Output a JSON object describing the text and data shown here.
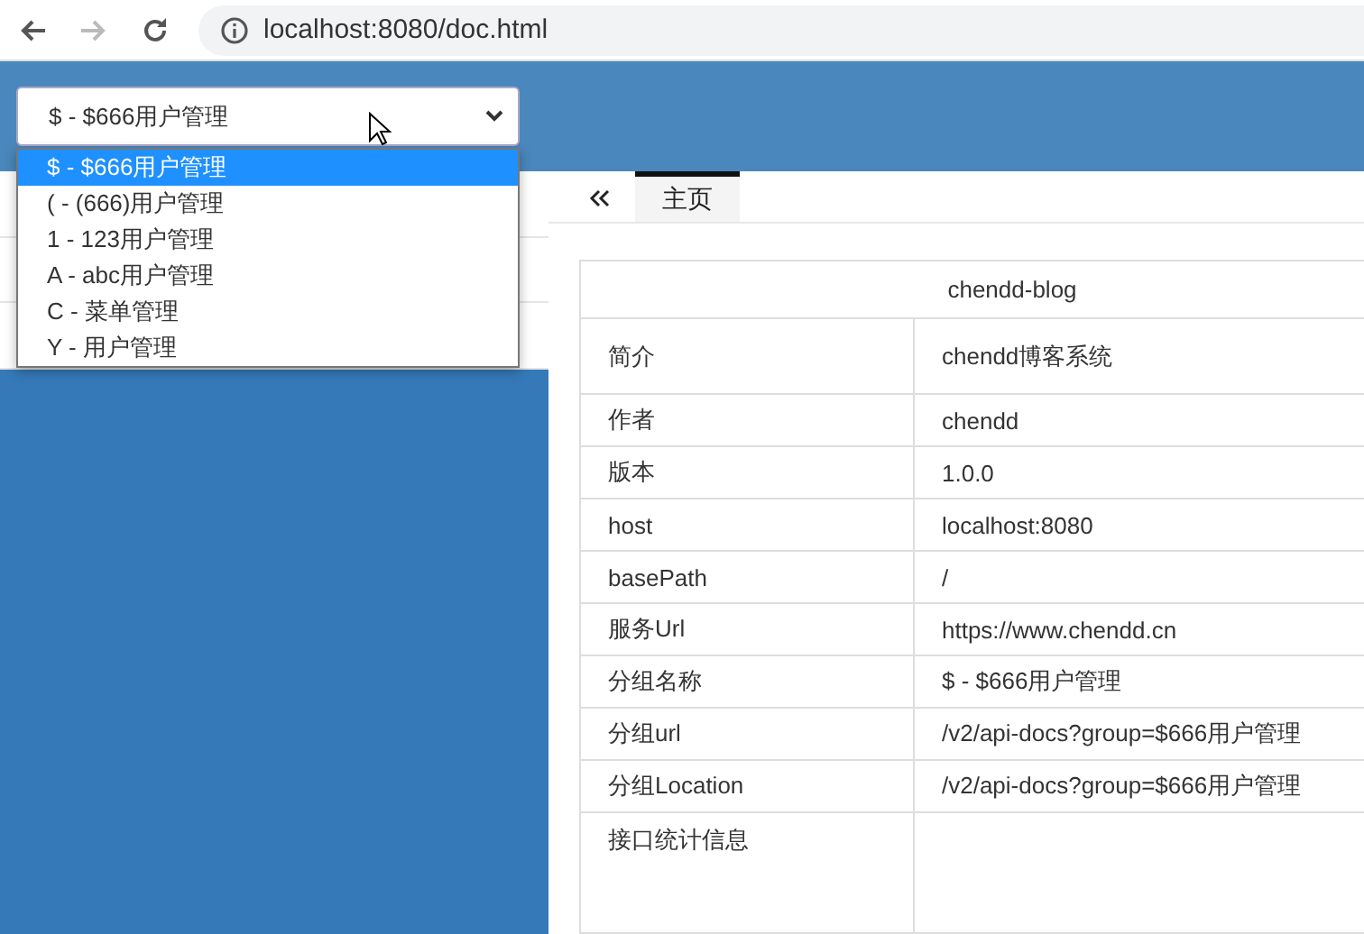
{
  "browser": {
    "nav": [
      {
        "kind": "back",
        "disabled": false
      },
      {
        "kind": "forward",
        "disabled": true
      },
      {
        "kind": "reload",
        "disabled": false
      }
    ],
    "url": "localhost:8080/doc.html"
  },
  "group_select": {
    "value": "$ - $666用户管理",
    "expanded": true,
    "options": [
      {
        "label": "$ - $666用户管理",
        "selected": true
      },
      {
        "label": "( - (666)用户管理",
        "selected": false
      },
      {
        "label": "1 - 123用户管理",
        "selected": false
      },
      {
        "label": "A - abc用户管理",
        "selected": false
      },
      {
        "label": "C - 菜单管理",
        "selected": false
      },
      {
        "label": "Y - 用户管理",
        "selected": false
      }
    ]
  },
  "tabs": [
    {
      "label": "主页",
      "selected": true
    }
  ],
  "info_table": {
    "title": "chendd-blog",
    "rows": [
      {
        "label": "简介",
        "value": "chendd博客系统"
      },
      {
        "label": "作者",
        "value": "chendd"
      },
      {
        "label": "版本",
        "value": "1.0.0"
      },
      {
        "label": "host",
        "value": "localhost:8080"
      },
      {
        "label": "basePath",
        "value": "/"
      },
      {
        "label": "服务Url",
        "value": "https://www.chendd.cn"
      },
      {
        "label": "分组名称",
        "value": "$ - $666用户管理"
      },
      {
        "label": "分组url",
        "value": "/v2/api-docs?group=$666用户管理"
      },
      {
        "label": "分组Location",
        "value": "/v2/api-docs?group=$666用户管理"
      },
      {
        "label": "接口统计信息",
        "value": ""
      }
    ]
  }
}
